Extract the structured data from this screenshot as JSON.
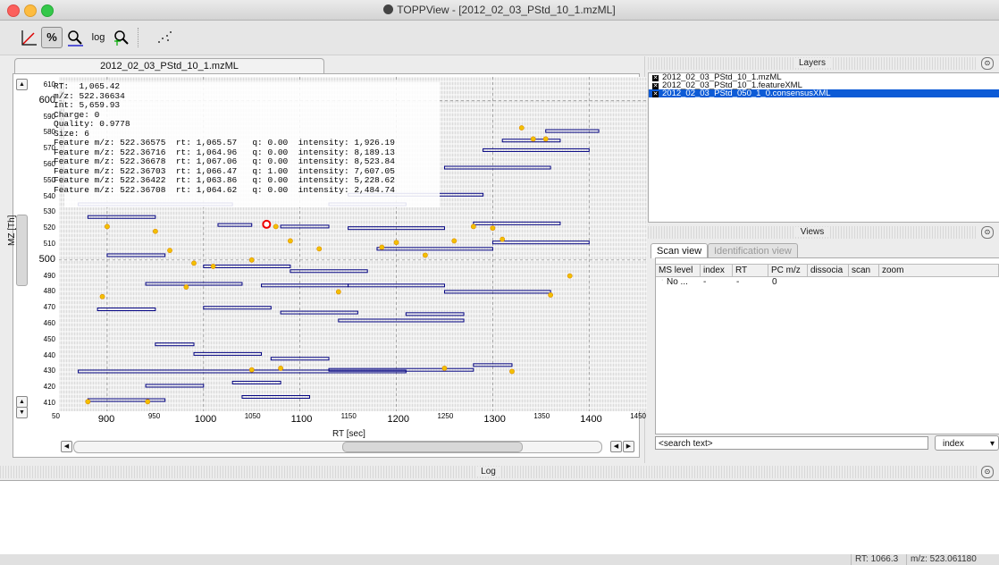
{
  "window": {
    "title": "TOPPView - [2012_02_03_PStd_10_1.mzML]"
  },
  "toolbar": {
    "buttons": [
      {
        "name": "linear-intensity",
        "icon": "axes-line-icon"
      },
      {
        "name": "percentage-intensity",
        "label": "%",
        "icon": "percentage-icon",
        "active": true
      },
      {
        "name": "snap-intensity",
        "icon": "zoom-snap-icon"
      },
      {
        "name": "log-intensity",
        "label": "log",
        "icon": "log-icon"
      },
      {
        "name": "show-projections",
        "icon": "grid-zoom-icon"
      },
      {
        "name": "show-points",
        "icon": "scatter-points-icon"
      }
    ]
  },
  "document": {
    "tab_label": "2012_02_03_PStd_10_1.mzML"
  },
  "plot": {
    "info_lines": [
      "RT:  1,065.42",
      "m/z: 522.36634",
      "Int: 5,659.93",
      "Charge: 0",
      "Quality: 0.9778",
      "Size: 6",
      "Feature m/z: 522.36575  rt: 1,065.57   q: 0.00  intensity: 1,926.19",
      "Feature m/z: 522.36716  rt: 1,064.96   q: 0.00  intensity: 8,189.13",
      "Feature m/z: 522.36678  rt: 1,067.06   q: 0.00  intensity: 8,523.84",
      "Feature m/z: 522.36703  rt: 1,066.47   q: 1.00  intensity: 7,607.05",
      "Feature m/z: 522.36422  rt: 1,063.86   q: 0.00  intensity: 5,228.62",
      "Feature m/z: 522.36708  rt: 1,064.62   q: 0.00  intensity: 2,484.74"
    ],
    "y_title": "MZ [Th]",
    "x_title": "RT [sec]",
    "y_major": [
      "600",
      "500"
    ],
    "y_minor": [
      "610",
      "590",
      "580",
      "570",
      "560",
      "550",
      "540",
      "530",
      "520",
      "510",
      "490",
      "480",
      "470",
      "460",
      "450",
      "440",
      "430",
      "420",
      "410"
    ],
    "x_major": [
      "900",
      "1000",
      "1100",
      "1200",
      "1300",
      "1400"
    ],
    "x_minor": [
      "50",
      "950",
      "1050",
      "1150",
      "1250",
      "1350",
      "1450"
    ]
  },
  "chart_data": {
    "type": "scatter",
    "title": "",
    "xlabel": "RT [sec]",
    "ylabel": "MZ [Th]",
    "xlim": [
      850,
      1460
    ],
    "ylim": [
      405,
      615
    ],
    "grid": true,
    "series": [
      {
        "name": "",
        "color": "#f2c000",
        "points": [
          [
            1065.4,
            522.4
          ],
          [
            1330,
            583
          ],
          [
            1342,
            576
          ],
          [
            1355,
            576
          ],
          [
            900,
            521
          ],
          [
            950,
            518
          ],
          [
            965,
            506
          ],
          [
            990,
            498
          ],
          [
            1010,
            496
          ],
          [
            1050,
            500
          ],
          [
            1075,
            521
          ],
          [
            1090,
            512
          ],
          [
            1120,
            507
          ],
          [
            1140,
            480
          ],
          [
            1185,
            508
          ],
          [
            1200,
            511
          ],
          [
            1260,
            512
          ],
          [
            1300,
            520
          ],
          [
            1310,
            513
          ],
          [
            1360,
            478
          ],
          [
            895,
            477
          ],
          [
            880,
            411
          ],
          [
            942,
            411
          ],
          [
            982,
            483
          ],
          [
            1050,
            431
          ],
          [
            1080,
            432
          ],
          [
            1250,
            432
          ],
          [
            1320,
            430
          ],
          [
            1230,
            503
          ],
          [
            1280,
            521
          ],
          [
            1380,
            490
          ]
        ]
      },
      {
        "name": "",
        "color": "#000080",
        "segments": [
          [
            870,
            1030,
            535
          ],
          [
            1130,
            1210,
            535
          ],
          [
            1150,
            1290,
            541
          ],
          [
            880,
            950,
            527
          ],
          [
            1015,
            1050,
            522
          ],
          [
            1080,
            1130,
            521
          ],
          [
            1150,
            1250,
            520
          ],
          [
            1280,
            1370,
            523
          ],
          [
            1300,
            1400,
            511
          ],
          [
            1180,
            1300,
            507
          ],
          [
            900,
            960,
            503
          ],
          [
            1000,
            1090,
            496
          ],
          [
            1090,
            1170,
            493
          ],
          [
            940,
            1040,
            485
          ],
          [
            1060,
            1150,
            484
          ],
          [
            1150,
            1250,
            484
          ],
          [
            1250,
            1360,
            480
          ],
          [
            890,
            950,
            469
          ],
          [
            1000,
            1070,
            470
          ],
          [
            1080,
            1160,
            467
          ],
          [
            1210,
            1270,
            466
          ],
          [
            1140,
            1270,
            462
          ],
          [
            950,
            990,
            447
          ],
          [
            990,
            1060,
            441
          ],
          [
            1070,
            1130,
            438
          ],
          [
            1130,
            1280,
            431
          ],
          [
            1280,
            1320,
            434
          ],
          [
            870,
            1210,
            430
          ],
          [
            1030,
            1080,
            423
          ],
          [
            940,
            1000,
            421
          ],
          [
            880,
            960,
            412
          ],
          [
            1040,
            1110,
            414
          ],
          [
            1310,
            1370,
            575
          ],
          [
            1355,
            1410,
            581
          ],
          [
            1290,
            1400,
            569
          ],
          [
            1250,
            1360,
            558
          ]
        ]
      }
    ]
  },
  "layers": {
    "title": "Layers",
    "items": [
      {
        "label": "2012_02_03_PStd_10_1.mzML",
        "checked": true,
        "selected": false
      },
      {
        "label": "2012_02_03_PStd_10_1.featureXML",
        "checked": true,
        "selected": false
      },
      {
        "label": "2012_02_03_PStd_050_1_0.consensusXML",
        "checked": true,
        "selected": true
      }
    ]
  },
  "views": {
    "title": "Views",
    "tabs": [
      "Scan view",
      "Identification view"
    ],
    "columns": [
      "MS level",
      "index",
      "RT",
      "PC m/z",
      "dissocia",
      "scan",
      "zoom"
    ],
    "rows": [
      [
        "No ...",
        "-",
        "-",
        "0",
        "",
        "",
        ""
      ]
    ],
    "search_placeholder": "<search text>",
    "search_field": "index"
  },
  "log": {
    "title": "Log"
  },
  "status": {
    "rt": "RT:  1066.3",
    "mz": "m/z: 523.061180"
  }
}
